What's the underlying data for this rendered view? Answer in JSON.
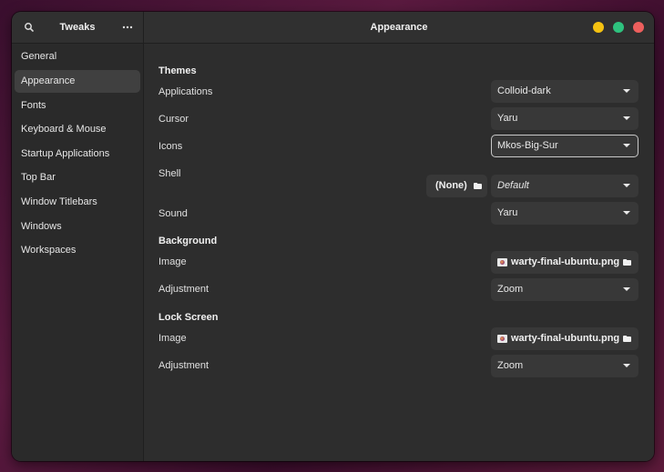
{
  "app": {
    "title": "Tweaks"
  },
  "page": {
    "title": "Appearance"
  },
  "sidebar": {
    "items": [
      {
        "label": "General"
      },
      {
        "label": "Appearance"
      },
      {
        "label": "Fonts"
      },
      {
        "label": "Keyboard & Mouse"
      },
      {
        "label": "Startup Applications"
      },
      {
        "label": "Top Bar"
      },
      {
        "label": "Window Titlebars"
      },
      {
        "label": "Windows"
      },
      {
        "label": "Workspaces"
      }
    ],
    "active": "Appearance"
  },
  "themes": {
    "heading": "Themes",
    "applications": {
      "label": "Applications",
      "value": "Colloid-dark"
    },
    "cursor": {
      "label": "Cursor",
      "value": "Yaru"
    },
    "icons": {
      "label": "Icons",
      "value": "Mkos-Big-Sur"
    },
    "shell": {
      "label": "Shell",
      "extension_button": "(None)",
      "value": "Default"
    },
    "sound": {
      "label": "Sound",
      "value": "Yaru"
    }
  },
  "background": {
    "heading": "Background",
    "image": {
      "label": "Image",
      "value": "warty-final-ubuntu.png"
    },
    "adjustment": {
      "label": "Adjustment",
      "value": "Zoom"
    }
  },
  "lock_screen": {
    "heading": "Lock Screen",
    "image": {
      "label": "Image",
      "value": "warty-final-ubuntu.png"
    },
    "adjustment": {
      "label": "Adjustment",
      "value": "Zoom"
    }
  },
  "icons": {
    "search": "search-icon",
    "menu": "more-horizontal-icon",
    "dropdown": "chevron-down-icon",
    "folder": "folder-icon",
    "image_thumb": "image-thumbnail-icon"
  },
  "colors": {
    "minimize": "#f5c211",
    "maximize": "#2ec27e",
    "close": "#ed5f5d",
    "window_bg": "#2d2d2d",
    "sidebar_selected": "#404040"
  }
}
